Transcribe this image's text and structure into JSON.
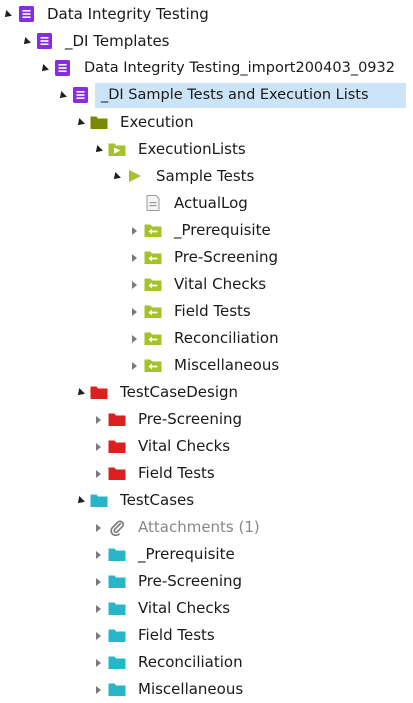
{
  "colors": {
    "purple": "#8a2be2",
    "olive": "#7a8a00",
    "lime": "#a6c22a",
    "red": "#dc1f1f",
    "teal": "#27b6c8",
    "selection": "#cce4f7"
  },
  "tree": [
    {
      "label": "Data Integrity Testing",
      "icon": "purple-doc-icon",
      "expanded": true
    },
    {
      "label": "_DI Templates",
      "icon": "purple-doc-icon",
      "expanded": true
    },
    {
      "label": "Data Integrity Testing_import200403_0932",
      "icon": "purple-doc-icon",
      "expanded": true
    },
    {
      "label": "_DI Sample Tests and Execution Lists",
      "icon": "purple-doc-icon",
      "expanded": true,
      "selected": true
    },
    {
      "label": "Execution",
      "icon": "olive-folder-icon",
      "expanded": true
    },
    {
      "label": "ExecutionLists",
      "icon": "lime-play-folder-icon",
      "expanded": true
    },
    {
      "label": "Sample Tests",
      "icon": "lime-play-icon",
      "expanded": true
    },
    {
      "label": "ActualLog",
      "icon": "log-file-icon"
    },
    {
      "label": "_Prerequisite",
      "icon": "lime-arrow-folder-icon",
      "expanded": false
    },
    {
      "label": "Pre-Screening",
      "icon": "lime-arrow-folder-icon",
      "expanded": false
    },
    {
      "label": "Vital Checks",
      "icon": "lime-arrow-folder-icon",
      "expanded": false
    },
    {
      "label": "Field Tests",
      "icon": "lime-arrow-folder-icon",
      "expanded": false
    },
    {
      "label": "Reconciliation",
      "icon": "lime-arrow-folder-icon",
      "expanded": false
    },
    {
      "label": "Miscellaneous",
      "icon": "lime-arrow-folder-icon",
      "expanded": false
    },
    {
      "label": "TestCaseDesign",
      "icon": "red-folder-icon",
      "expanded": true
    },
    {
      "label": "Pre-Screening",
      "icon": "red-folder-icon",
      "expanded": false
    },
    {
      "label": "Vital Checks",
      "icon": "red-folder-icon",
      "expanded": false
    },
    {
      "label": "Field Tests",
      "icon": "red-folder-icon",
      "expanded": false
    },
    {
      "label": "TestCases",
      "icon": "teal-folder-icon",
      "expanded": true
    },
    {
      "label": "Attachments (1)",
      "icon": "paperclip-icon",
      "expanded": false,
      "muted": true
    },
    {
      "label": "_Prerequisite",
      "icon": "teal-folder-icon",
      "expanded": false
    },
    {
      "label": "Pre-Screening",
      "icon": "teal-folder-icon",
      "expanded": false
    },
    {
      "label": "Vital Checks",
      "icon": "teal-folder-icon",
      "expanded": false
    },
    {
      "label": "Field Tests",
      "icon": "teal-folder-icon",
      "expanded": false
    },
    {
      "label": "Reconciliation",
      "icon": "teal-folder-icon",
      "expanded": false
    },
    {
      "label": "Miscellaneous",
      "icon": "teal-folder-icon",
      "expanded": false
    }
  ]
}
